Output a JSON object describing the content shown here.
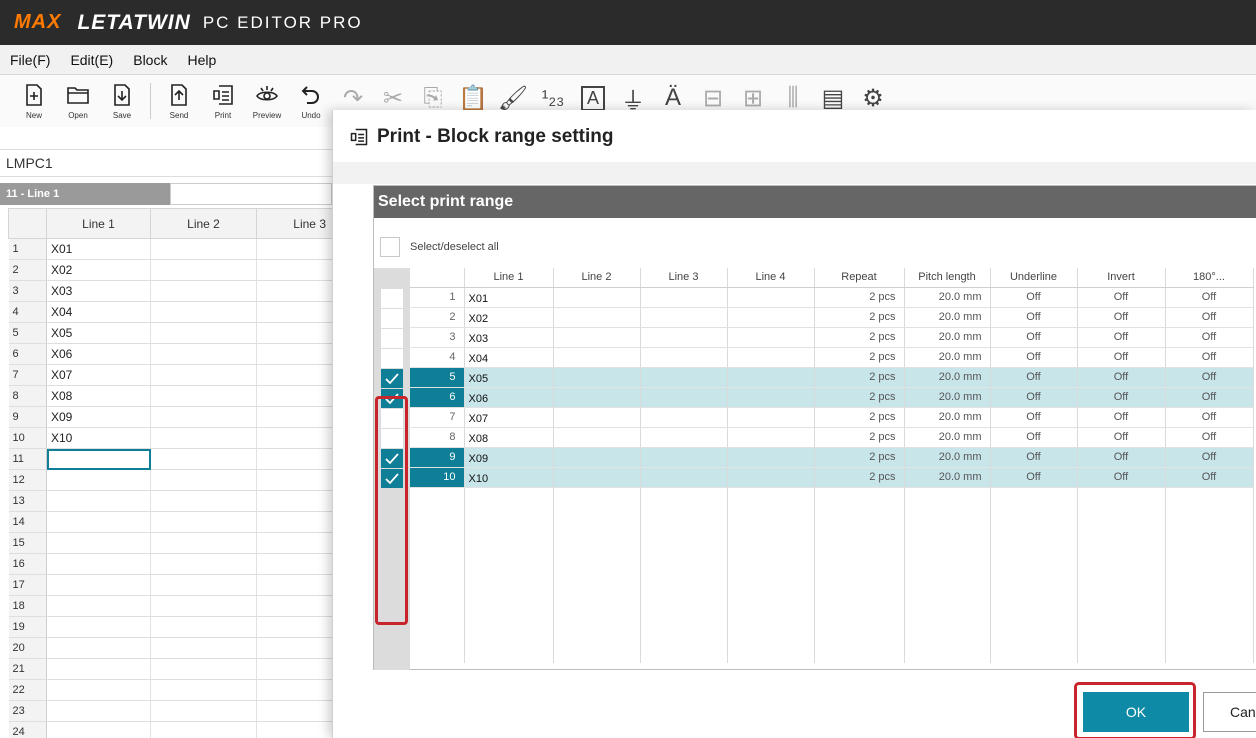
{
  "app": {
    "brand_max": "MAX",
    "brand_name": "LETATWIN",
    "brand_sub": "PC EDITOR PRO"
  },
  "menu": [
    "File(F)",
    "Edit(E)",
    "Block",
    "Help"
  ],
  "toolbar": {
    "new": "New",
    "open": "Open",
    "save": "Save",
    "send": "Send",
    "print": "Print",
    "preview": "Preview",
    "undo": "Undo"
  },
  "file_name": "LMPC1",
  "cell_ref": "11 - Line 1",
  "editor": {
    "columns": [
      "Line 1",
      "Line 2",
      "Line 3"
    ],
    "row_numbers": [
      "1",
      "2",
      "3",
      "4",
      "5",
      "6",
      "7",
      "8",
      "9",
      "10",
      "11",
      "12",
      "13",
      "14",
      "15",
      "16",
      "17",
      "18",
      "19",
      "20",
      "21",
      "22",
      "23",
      "24"
    ],
    "values": [
      "X01",
      "X02",
      "X03",
      "X04",
      "X05",
      "X06",
      "X07",
      "X08",
      "X09",
      "X10",
      "",
      "",
      "",
      "",
      "",
      "",
      "",
      "",
      "",
      "",
      "",
      "",
      "",
      ""
    ],
    "selected_row": 11
  },
  "dialog": {
    "title": "Print - Block range setting",
    "panel_title": "Select print range",
    "select_all": "Select/deselect all",
    "columns": [
      "Line 1",
      "Line 2",
      "Line 3",
      "Line 4",
      "Repeat",
      "Pitch length",
      "Underline",
      "Invert",
      "180°..."
    ],
    "rows": [
      {
        "no": "1",
        "line1": "X01",
        "repeat": "2 pcs",
        "pitch": "20.0 mm",
        "underline": "Off",
        "invert": "Off",
        "rot": "Off",
        "checked": false
      },
      {
        "no": "2",
        "line1": "X02",
        "repeat": "2 pcs",
        "pitch": "20.0 mm",
        "underline": "Off",
        "invert": "Off",
        "rot": "Off",
        "checked": false
      },
      {
        "no": "3",
        "line1": "X03",
        "repeat": "2 pcs",
        "pitch": "20.0 mm",
        "underline": "Off",
        "invert": "Off",
        "rot": "Off",
        "checked": false
      },
      {
        "no": "4",
        "line1": "X04",
        "repeat": "2 pcs",
        "pitch": "20.0 mm",
        "underline": "Off",
        "invert": "Off",
        "rot": "Off",
        "checked": false
      },
      {
        "no": "5",
        "line1": "X05",
        "repeat": "2 pcs",
        "pitch": "20.0 mm",
        "underline": "Off",
        "invert": "Off",
        "rot": "Off",
        "checked": true
      },
      {
        "no": "6",
        "line1": "X06",
        "repeat": "2 pcs",
        "pitch": "20.0 mm",
        "underline": "Off",
        "invert": "Off",
        "rot": "Off",
        "checked": true
      },
      {
        "no": "7",
        "line1": "X07",
        "repeat": "2 pcs",
        "pitch": "20.0 mm",
        "underline": "Off",
        "invert": "Off",
        "rot": "Off",
        "checked": false
      },
      {
        "no": "8",
        "line1": "X08",
        "repeat": "2 pcs",
        "pitch": "20.0 mm",
        "underline": "Off",
        "invert": "Off",
        "rot": "Off",
        "checked": false
      },
      {
        "no": "9",
        "line1": "X09",
        "repeat": "2 pcs",
        "pitch": "20.0 mm",
        "underline": "Off",
        "invert": "Off",
        "rot": "Off",
        "checked": true
      },
      {
        "no": "10",
        "line1": "X10",
        "repeat": "2 pcs",
        "pitch": "20.0 mm",
        "underline": "Off",
        "invert": "Off",
        "rot": "Off",
        "checked": true
      }
    ],
    "ok_label": "OK",
    "cancel_label": "Cancel"
  },
  "colors": {
    "accent": "#0e8aa6",
    "highlight": "#c8e5ea",
    "annotation": "#c7252b",
    "brand_orange": "#ff7a00"
  }
}
